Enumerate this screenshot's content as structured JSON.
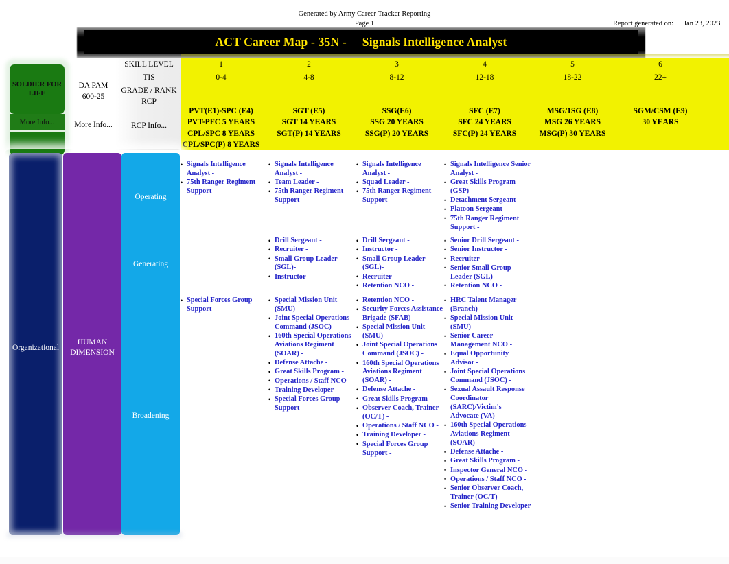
{
  "meta": {
    "generated_by": "Generated by Army Career Tracker Reporting",
    "page_label": "Page 1",
    "report_generated_label": "Report generated on:",
    "report_generated_date": "Jan 23, 2023"
  },
  "banner": {
    "title": "ACT Career Map - 35N -     Signals Intelligence Analyst",
    "text_color": "#ffe400",
    "background_color": "#000000"
  },
  "left_panels": {
    "soldier_for_life": {
      "title": "SOLDIER FOR\nLIFE",
      "more_info": "More Info...",
      "color": "#1a7a12"
    },
    "da_pam": {
      "line1": "DA PAM",
      "line2": "600-25",
      "more_info": "More Info..."
    }
  },
  "header_table": {
    "row_labels": [
      "SKILL LEVEL",
      "TIS",
      "GRADE / RANK",
      "RCP",
      "RCP Info..."
    ],
    "skill_levels": [
      "1",
      "2",
      "3",
      "4",
      "5",
      "6"
    ],
    "tis": [
      "0-4",
      "4-8",
      "8-12",
      "12-18",
      "18-22",
      "22+"
    ],
    "grades": [
      "PVT(E1)-SPC (E4)",
      "SGT (E5)",
      "SSG(E6)",
      "SFC (E7)",
      "MSG/1SG (E8)",
      "SGM/CSM (E9)"
    ],
    "rcp": [
      [
        "PVT-PFC 5 YEARS",
        "CPL/SPC 8 YEARS",
        "CPL/SPC(P) 8 YEARS"
      ],
      [
        "SGT  14 YEARS",
        "SGT(P) 14   YEARS"
      ],
      [
        "SSG 20 YEARS",
        "SSG(P) 20 YEARS"
      ],
      [
        "SFC 24 YEARS",
        "SFC(P) 24 YEARS"
      ],
      [
        "MSG 26 YEARS",
        "MSG(P) 30 YEARS"
      ],
      [
        "30 YEARS"
      ]
    ],
    "background_color": "#f2f200"
  },
  "dimensions": {
    "organizational": {
      "label": "Organizational",
      "color": "#0a1f6b"
    },
    "human": {
      "label": "HUMAN\nDIMENSION",
      "color": "#7428a8"
    },
    "tracks": {
      "color": "#13a8e8",
      "items": [
        {
          "label": "Operating"
        },
        {
          "label": "Generating"
        },
        {
          "label": "Broadening"
        }
      ]
    }
  },
  "career_map": {
    "columns": [
      {
        "skill_level": "1",
        "operating": [
          "Signals Intelligence Analyst  -",
          "75th Ranger Regiment Support    -"
        ],
        "generating": [],
        "broadening": [
          "Special Forces Group Support    -"
        ]
      },
      {
        "skill_level": "2",
        "operating": [
          "Signals Intelligence Analyst -",
          "Team Leader     -",
          "75th Ranger Regiment Support    -"
        ],
        "generating": [
          "Drill Sergeant    -",
          "Recruiter   -",
          "Small Group Leader (SGL)-",
          "Instructor    -"
        ],
        "broadening": [
          "Special Mission Unit (SMU)-",
          "Joint Special Operations Command (JSOC)   -",
          "160th Special Operations Aviations Regiment (SOAR)   -",
          "Defense Attache      -",
          "Great Skills Program      -",
          "Operations / Staff NCO      -",
          "Training Developer     -",
          "Special Forces Group Support    -"
        ]
      },
      {
        "skill_level": "3",
        "operating": [
          "Signals Intelligence Analyst -",
          "Squad Leader     -",
          "75th Ranger Regiment Support    -"
        ],
        "generating": [
          "Drill Sergeant    -",
          "Instructor    -",
          "Small Group Leader (SGL)-",
          "Recruiter   -",
          "Retention NCO    -"
        ],
        "broadening": [
          "Retention NCO    -",
          "Security Forces Assistance Brigade (SFAB)-",
          "Special Mission Unit (SMU)-",
          "Joint Special Operations Command (JSOC)   -",
          "160th Special Operations Aviations Regiment (SOAR)   -",
          "Defense Attache      -",
          "Great Skills Program      -",
          "Observer Coach, Trainer (OC/T) -",
          "Operations / Staff NCO       -",
          "Training Developer     -",
          "Special Forces Group Support    -"
        ]
      },
      {
        "skill_level": "4",
        "operating": [
          "Signals Intelligence Senior Analyst    -",
          "Great Skills Program (GSP)-",
          "Detachment Sergeant       -",
          "Platoon Sergeant      -",
          "75th Ranger Regiment Support    -"
        ],
        "generating": [
          "Senior Drill Sergeant     -",
          "Senior Instructor     -",
          "Recruiter   -",
          "Senior Small Group Leader (SGL)  -",
          "Retention NCO    -"
        ],
        "broadening": [
          "HRC Talent Manager (Branch)   -",
          "Special Mission Unit (SMU)-",
          "Senior Career Management NCO     -",
          "Equal Opportunity Advisor  -",
          "Joint Special Operations Command (JSOC)   -",
          "Sexual Assault Response Coordinator (SARC)/Victim's Advocate (VA)  -",
          "160th Special Operations Aviations Regiment (SOAR)  -",
          "Defense Attache      -",
          "Great Skills Program     -",
          "Inspector General NCO   -",
          "Operations / Staff NCO   -",
          "Senior Observer Coach, Trainer (OC/T)  -",
          "Senior Training Developer  -"
        ]
      },
      {
        "skill_level": "5",
        "operating": [],
        "generating": [],
        "broadening": []
      },
      {
        "skill_level": "6",
        "operating": [],
        "generating": [],
        "broadening": []
      }
    ]
  }
}
